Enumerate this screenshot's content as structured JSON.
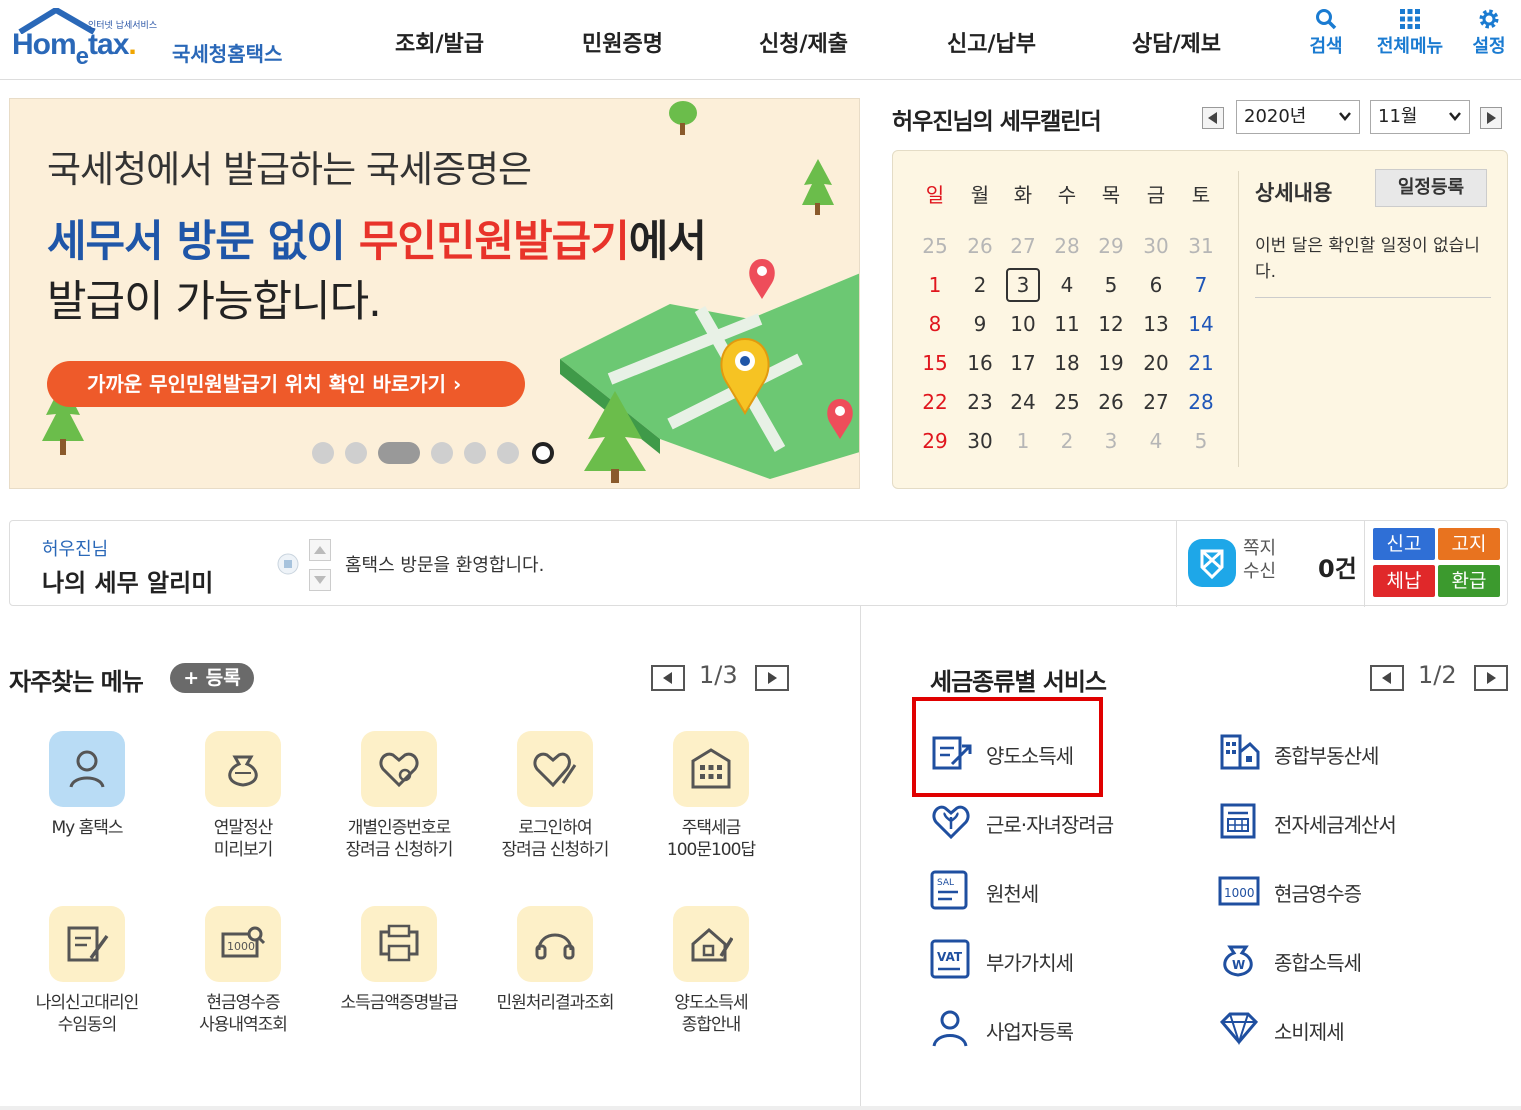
{
  "header": {
    "logo_tagline": "인터넷 납세서비스",
    "logo_name": "Hometax",
    "logo_kor": "국세청홈택스",
    "nav": [
      "조회/발급",
      "민원증명",
      "신청/제출",
      "신고/납부",
      "상담/제보"
    ],
    "utilities": [
      {
        "label": "검색",
        "icon": "search-icon"
      },
      {
        "label": "전체메뉴",
        "icon": "grid-menu-icon"
      },
      {
        "label": "설정",
        "icon": "gear-icon"
      }
    ],
    "accent": "#1a7bd1"
  },
  "banner": {
    "line1": "국세청에서 발급하는 국세증명은",
    "line2_blue": "세무서 방문 없이 ",
    "line2_red": "무인민원발급기",
    "line2_black": "에서",
    "line3": "발급이 가능합니다.",
    "cta": "가까운 무인민원발급기 위치 확인 바로가기",
    "slides": 7,
    "active_slide": 3
  },
  "calendar": {
    "title": "허우진님의 세무캘린더",
    "year": "2020년",
    "month": "11월",
    "weekdays": [
      "일",
      "월",
      "화",
      "수",
      "목",
      "금",
      "토"
    ],
    "weeks": [
      [
        "25",
        "26",
        "27",
        "28",
        "29",
        "30",
        "31"
      ],
      [
        "1",
        "2",
        "3",
        "4",
        "5",
        "6",
        "7"
      ],
      [
        "8",
        "9",
        "10",
        "11",
        "12",
        "13",
        "14"
      ],
      [
        "15",
        "16",
        "17",
        "18",
        "19",
        "20",
        "21"
      ],
      [
        "22",
        "23",
        "24",
        "25",
        "26",
        "27",
        "28"
      ],
      [
        "29",
        "30",
        "1",
        "2",
        "3",
        "4",
        "5"
      ]
    ],
    "today": "3",
    "detail_title": "상세내용",
    "schedule_button": "일정등록",
    "detail_text": "이번 달은 확인할 일정이 없습니다."
  },
  "alarm": {
    "user": "허우진님",
    "title": "나의 세무 알리미",
    "message": "홈택스 방문을 환영합니다.",
    "memo_label_1": "쪽지",
    "memo_label_2": "수신",
    "memo_count": "0건",
    "buttons": [
      {
        "label": "신고",
        "color": "#2f6fd6"
      },
      {
        "label": "고지",
        "color": "#e8731f"
      },
      {
        "label": "체납",
        "color": "#e0282a"
      },
      {
        "label": "환급",
        "color": "#3c9a2e"
      }
    ]
  },
  "favorites": {
    "title": "자주찾는 메뉴",
    "register": "등록",
    "page": "1/3",
    "items": [
      {
        "label": "My 홈택스",
        "icon": "user-icon"
      },
      {
        "label": "연말정산\n미리보기",
        "icon": "money-bag-icon"
      },
      {
        "label": "개별인증번호로\n장려금 신청하기",
        "icon": "heart-key-icon"
      },
      {
        "label": "로그인하여\n장려금 신청하기",
        "icon": "heart-pen-icon"
      },
      {
        "label": "주택세금\n100문100답",
        "icon": "building-icon"
      },
      {
        "label": "나의신고대리인\n수임동의",
        "icon": "document-pen-icon"
      },
      {
        "label": "현금영수증\n사용내역조회",
        "icon": "receipt-search-icon"
      },
      {
        "label": "소득금액증명발급",
        "icon": "printer-icon"
      },
      {
        "label": "민원처리결과조회",
        "icon": "headset-icon"
      },
      {
        "label": "양도소득세\n종합안내",
        "icon": "house-pen-icon"
      }
    ]
  },
  "tax_services": {
    "title": "세금종류별 서비스",
    "page": "1/2",
    "items": [
      {
        "label": "양도소득세",
        "icon": "document-transfer-icon"
      },
      {
        "label": "종합부동산세",
        "icon": "buildings-icon"
      },
      {
        "label": "근로·자녀장려금",
        "icon": "heart-sprout-icon"
      },
      {
        "label": "전자세금계산서",
        "icon": "invoice-icon"
      },
      {
        "label": "원천세",
        "icon": "salary-doc-icon"
      },
      {
        "label": "현금영수증",
        "icon": "cash-receipt-icon"
      },
      {
        "label": "부가가치세",
        "icon": "vat-icon"
      },
      {
        "label": "종합소득세",
        "icon": "won-bag-icon"
      },
      {
        "label": "사업자등록",
        "icon": "person-icon"
      },
      {
        "label": "소비제세",
        "icon": "diamond-icon"
      }
    ],
    "highlight_color": "#e00000"
  }
}
